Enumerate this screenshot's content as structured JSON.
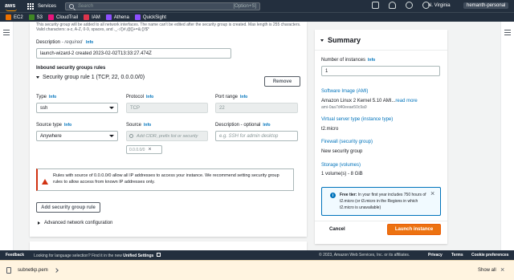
{
  "topnav": {
    "logo": "aws",
    "services_label": "Services",
    "search_placeholder": "Search",
    "search_shortcut": "[Option+S]",
    "region": "N. Virginia",
    "account": "hemanth-personal"
  },
  "favorites": [
    {
      "label": "EC2",
      "color": "#ed7100"
    },
    {
      "label": "S3",
      "color": "#3f8624"
    },
    {
      "label": "CloudTrail",
      "color": "#e7157b"
    },
    {
      "label": "IAM",
      "color": "#dd344c"
    },
    {
      "label": "Athena",
      "color": "#8c4fff"
    },
    {
      "label": "QuickSight",
      "color": "#8c4fff"
    }
  ],
  "form": {
    "intro_text": "This security group will be added to all network interfaces. The name can't be edited after the security group is created. Max length is 255 characters. Valid characters: a-z, A-Z, 0-9, spaces, and ._-:/()#,@[]+=&;{}!$*",
    "description_label": "Description",
    "description_required": "- required",
    "info": "Info",
    "description_value": "launch-wizard-2 created 2023-02-02T13:33:27.474Z",
    "inbound_header": "Inbound security groups rules",
    "rule_title": "Security group rule 1 (TCP, 22, 0.0.0.0/0)",
    "remove_label": "Remove",
    "type_label": "Type",
    "type_value": "ssh",
    "protocol_label": "Protocol",
    "protocol_value": "TCP",
    "port_label": "Port range",
    "port_value": "22",
    "source_type_label": "Source type",
    "source_type_value": "Anywhere",
    "source_label": "Source",
    "source_placeholder": "Add CIDR, prefix list or security",
    "source_token": "0.0.0.0/0",
    "desc_opt_label": "Description - optional",
    "desc_opt_placeholder": "e.g. SSH for admin desktop",
    "alert_text": "Rules with source of 0.0.0.0/0 allow all IP addresses to access your instance. We recommend setting security group rules to allow access from known IP addresses only.",
    "add_rule_label": "Add security group rule",
    "advanced_label": "Advanced network configuration"
  },
  "summary": {
    "title": "Summary",
    "instances_label": "Number of instances",
    "info": "Info",
    "instances_value": "1",
    "ami_label": "Software Image (AMI)",
    "ami_value": "Amazon Linux 2 Kernel 5.10 AMI...",
    "read_more": "read more",
    "ami_id": "ami-0aa7d40eeae50c9a9",
    "server_type_label": "Virtual server type (instance type)",
    "server_type_value": "t2.micro",
    "firewall_label": "Firewall (security group)",
    "firewall_value": "New security group",
    "storage_label": "Storage (volumes)",
    "storage_value": "1 volume(s) - 8 GiB",
    "free_tier_bold": "Free tier:",
    "free_tier_text": " In your first year includes 750 hours of t2.micro (or t3.micro in the Regions in which t2.micro is unavailable)",
    "cancel_label": "Cancel",
    "launch_label": "Launch instance"
  },
  "footer": {
    "feedback": "Feedback",
    "lang_text": "Looking for language selection? Find it in the new ",
    "unified_settings": "Unified Settings",
    "copyright": "© 2023, Amazon Web Services, Inc. or its affiliates.",
    "privacy": "Privacy",
    "terms": "Terms",
    "cookie": "Cookie preferences"
  },
  "downloads": {
    "filename": "subnetkp.pem",
    "show_all": "Show all"
  }
}
